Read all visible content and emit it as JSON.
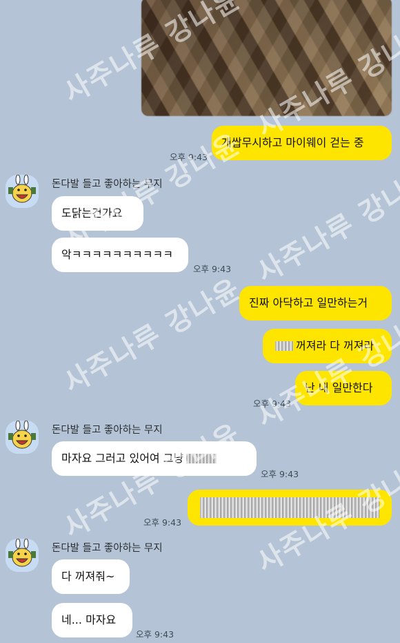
{
  "sender_name": "돈다발 들고 좋아하는 무지",
  "watermark": "사주나루 강나윤",
  "messages": [
    {
      "text": "개쌉무시하고 마이웨이 걷는 중"
    },
    {
      "text": "도닭는건가요"
    },
    {
      "text": "악ㅋㅋㅋㅋㅋㅋㅋㅋㅋㅋ"
    },
    {
      "text": "진짜 아닥하고 일만하는거"
    },
    {
      "text": "꺼져라 다 꺼져라"
    },
    {
      "text": "난 내 일만한다"
    },
    {
      "text": "마자요 그러고 있어여 그냥"
    },
    {
      "text": "다 꺼져줘~"
    },
    {
      "text": "네... 마자요"
    }
  ],
  "times": [
    "오후 9:43",
    "오후 9:43",
    "오후 9:43",
    "오후 9:43",
    "오후 9:43",
    "오후 9:43"
  ],
  "colors": {
    "my_bubble": "#fee500",
    "their_bubble": "#ffffff",
    "background": "#b4c4d6"
  },
  "icons": {
    "avatar": "muji-avatar-icon"
  }
}
